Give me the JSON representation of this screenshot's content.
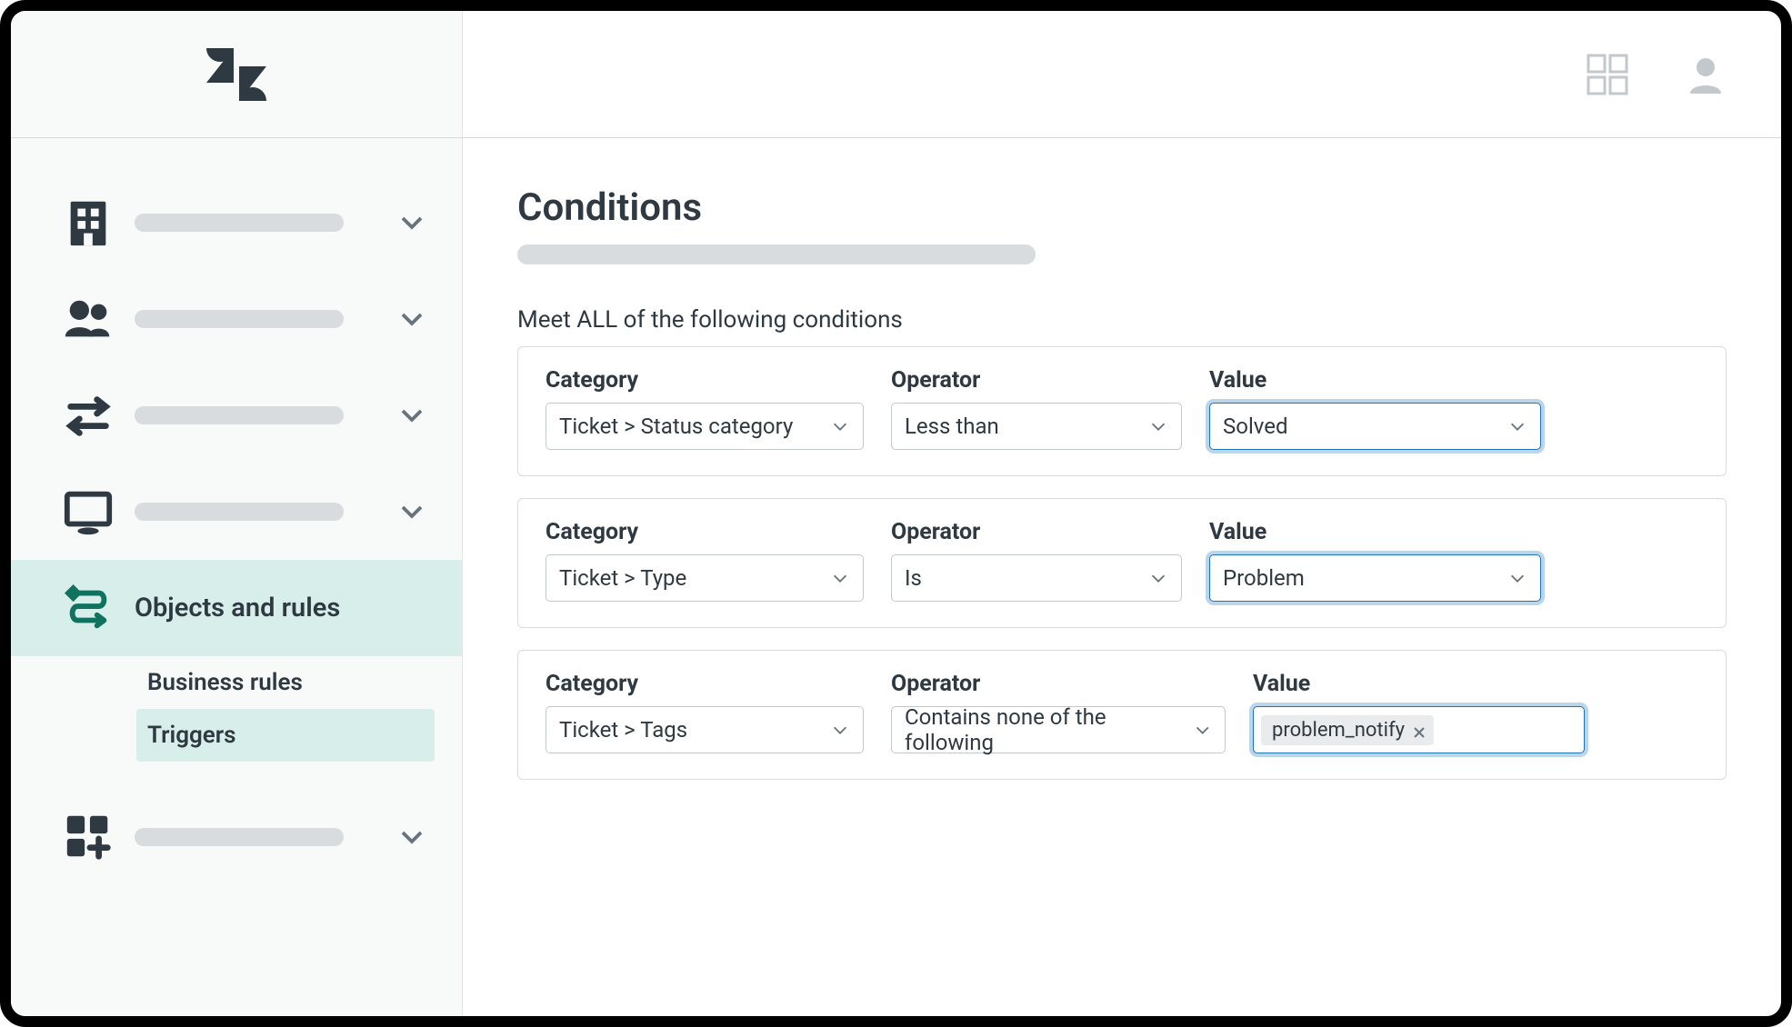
{
  "sidebar": {
    "active_label": "Objects and rules",
    "submenu": {
      "heading": "Business rules",
      "active_item": "Triggers"
    }
  },
  "page": {
    "title": "Conditions",
    "section_label": "Meet ALL of the following conditions"
  },
  "labels": {
    "category": "Category",
    "operator": "Operator",
    "value": "Value"
  },
  "conditions": [
    {
      "category": "Ticket > Status category",
      "operator": "Less than",
      "value": "Solved"
    },
    {
      "category": "Ticket > Type",
      "operator": "Is",
      "value": "Problem"
    },
    {
      "category": "Ticket > Tags",
      "operator": "Contains none of the following",
      "tag": "problem_notify"
    }
  ]
}
